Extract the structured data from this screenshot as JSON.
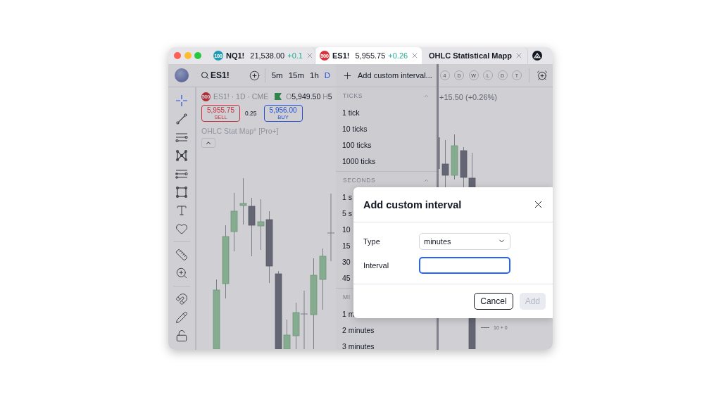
{
  "tabs": [
    {
      "kind": "symbol",
      "badge": "100",
      "color": "#1f9bb3",
      "symbol": "NQ1!",
      "price": "21,538.00",
      "change": "+0.1",
      "selected": false
    },
    {
      "kind": "symbol",
      "badge": "500",
      "color": "#d8343d",
      "symbol": "ES1!",
      "price": "5,955.75",
      "change": "+0.26",
      "selected": true
    },
    {
      "kind": "indicator",
      "title": "OHLC Statistical Mapp",
      "selected": false
    },
    {
      "kind": "indicator",
      "selected": false
    }
  ],
  "toolbar": {
    "symbol": "ES1!",
    "intervals": [
      {
        "label": "5m",
        "selected": false
      },
      {
        "label": "15m",
        "selected": false
      },
      {
        "label": "1h",
        "selected": false
      },
      {
        "label": "D",
        "selected": true
      }
    ],
    "quick_buttons": [
      "4",
      "D",
      "W",
      "L",
      "D",
      "T"
    ]
  },
  "tool_groups": [
    {
      "tools": [
        {
          "kind": "crosshair",
          "selected": true
        },
        {
          "kind": "trend-line",
          "selected": false
        },
        {
          "kind": "fib",
          "selected": false
        },
        {
          "kind": "pattern",
          "selected": false
        },
        {
          "kind": "forecast",
          "selected": false
        },
        {
          "kind": "rectangle",
          "selected": false
        },
        {
          "kind": "text",
          "selected": false
        },
        {
          "kind": "heart",
          "selected": false
        }
      ]
    },
    {
      "tools": [
        {
          "kind": "ruler",
          "selected": false
        },
        {
          "kind": "zoom",
          "selected": false
        }
      ]
    },
    {
      "tools": [
        {
          "kind": "magnet",
          "selected": false
        },
        {
          "kind": "pencil",
          "selected": false
        },
        {
          "kind": "lock",
          "selected": false
        }
      ]
    }
  ],
  "legend": {
    "badge": "500",
    "title": "ES1! · 1D · CME",
    "open_label": "O",
    "open": "5,949.50",
    "high_label": "H",
    "high": "5",
    "sell": {
      "price": "5,955.75",
      "label": "SELL"
    },
    "spread": "0.25",
    "buy": {
      "price": "5,956.00",
      "label": "BUY"
    },
    "indicator": "OHLC Stat Map° [Pro+]",
    "change": "+15.50 (+0.26%)",
    "scale_label": "10 + 0"
  },
  "menu": {
    "add_label": "Add custom interval...",
    "sections": [
      {
        "title": "TICKS",
        "expanded": true,
        "items": [
          "1 tick",
          "10 ticks",
          "100 ticks",
          "1000 ticks"
        ]
      },
      {
        "title": "SECONDS",
        "expanded": true,
        "items": [
          "1 s",
          "5 s",
          "10",
          "15",
          "30",
          "45"
        ]
      },
      {
        "title": "MI",
        "items": [
          "1 m",
          "2 minutes",
          "3 minutes"
        ]
      }
    ]
  },
  "dialog": {
    "title": "Add custom interval",
    "fields": [
      {
        "kind": "select",
        "label": "Type",
        "value": "minutes"
      },
      {
        "kind": "input",
        "label": "Interval",
        "focused": true
      }
    ],
    "buttons": [
      {
        "label": "Cancel",
        "disabled": false
      },
      {
        "label": "Add",
        "disabled": true
      }
    ]
  }
}
